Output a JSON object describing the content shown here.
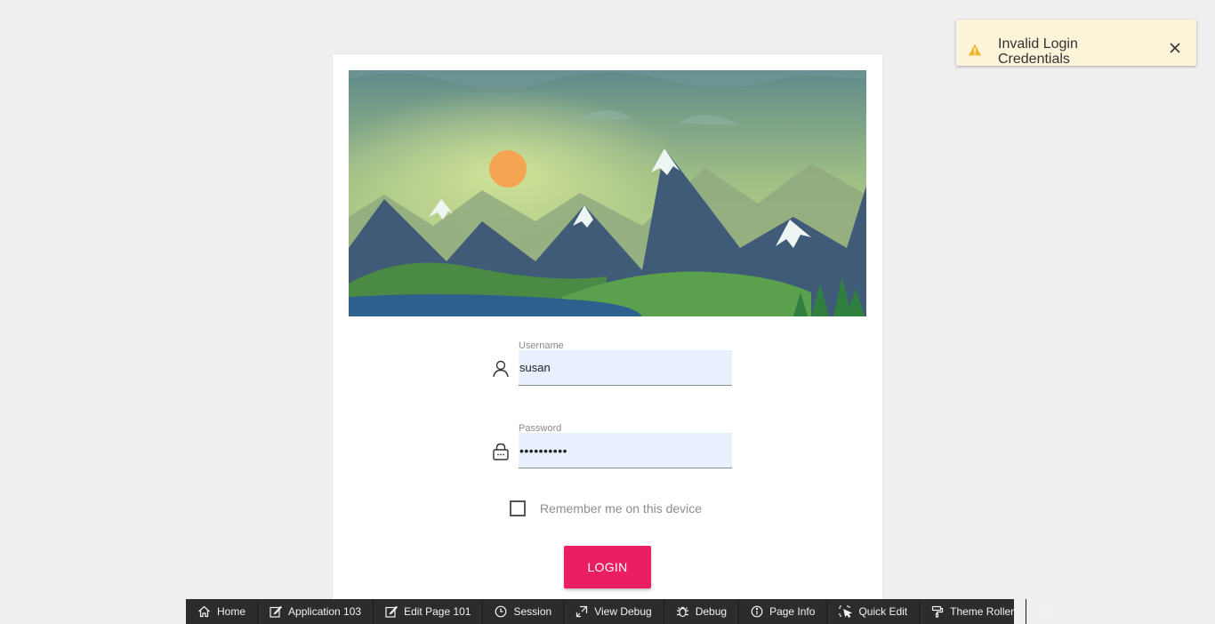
{
  "login": {
    "username_label": "Username",
    "username_value": "susan",
    "password_label": "Password",
    "password_value": "••••••••••",
    "remember_label": "Remember me on this device",
    "login_button": "LOGIN"
  },
  "toast": {
    "message": "Invalid Login Credentials",
    "icon": "warning-icon",
    "close_icon": "close-icon"
  },
  "devbar": {
    "items": [
      {
        "label": "Home",
        "icon": "home-icon"
      },
      {
        "label": "Application 103",
        "icon": "edit-icon"
      },
      {
        "label": "Edit Page 101",
        "icon": "edit-icon"
      },
      {
        "label": "Session",
        "icon": "clock-icon"
      },
      {
        "label": "View Debug",
        "icon": "debug-view-icon"
      },
      {
        "label": "Debug",
        "icon": "bug-icon"
      },
      {
        "label": "Page Info",
        "icon": "info-icon"
      },
      {
        "label": "Quick Edit",
        "icon": "quick-edit-icon"
      },
      {
        "label": "Theme Roller",
        "icon": "paint-roller-icon"
      },
      {
        "label": "",
        "icon": "gear-icon"
      }
    ]
  },
  "colors": {
    "background": "#efefef",
    "accent": "#e91e63",
    "input_bg": "#e8f0fe",
    "toast_bg": "#fbf4d9",
    "devbar_bg": "#2c2c2c"
  }
}
